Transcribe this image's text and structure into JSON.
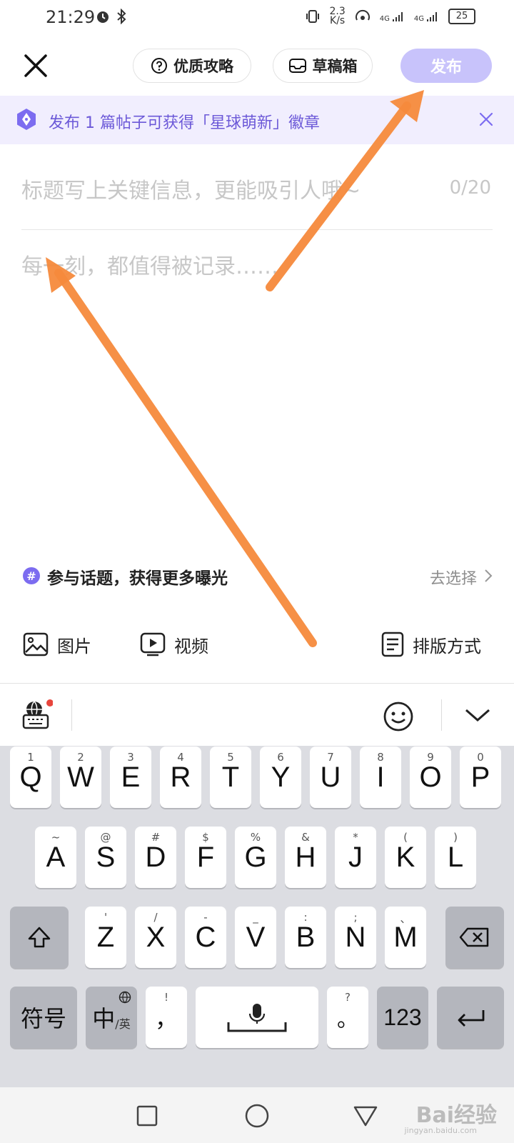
{
  "status_bar": {
    "time": "21:29",
    "net_speed_value": "2.3",
    "net_speed_unit": "K/s",
    "signal_1": "4G",
    "signal_2": "4G",
    "battery": "25"
  },
  "top_bar": {
    "guide_label": "优质攻略",
    "drafts_label": "草稿箱",
    "publish_label": "发布"
  },
  "banner": {
    "text": "发布 1 篇帖子可获得「星球萌新」徽章"
  },
  "editor": {
    "title_placeholder": "标题写上关键信息，更能吸引人哦~",
    "title_counter": "0/20",
    "body_placeholder": "每一刻，都值得被记录……"
  },
  "topic": {
    "icon": "#",
    "label": "参与话题，获得更多曝光",
    "select_label": "去选择"
  },
  "toolbar": {
    "image_label": "图片",
    "video_label": "视频",
    "layout_label": "排版方式"
  },
  "keyboard": {
    "row1": [
      {
        "main": "Q",
        "sup": "1"
      },
      {
        "main": "W",
        "sup": "2"
      },
      {
        "main": "E",
        "sup": "3"
      },
      {
        "main": "R",
        "sup": "4"
      },
      {
        "main": "T",
        "sup": "5"
      },
      {
        "main": "Y",
        "sup": "6"
      },
      {
        "main": "U",
        "sup": "7"
      },
      {
        "main": "I",
        "sup": "8"
      },
      {
        "main": "O",
        "sup": "9"
      },
      {
        "main": "P",
        "sup": "0"
      }
    ],
    "row2": [
      {
        "main": "A",
        "sup": "~"
      },
      {
        "main": "S",
        "sup": "@"
      },
      {
        "main": "D",
        "sup": "#"
      },
      {
        "main": "F",
        "sup": "$"
      },
      {
        "main": "G",
        "sup": "%"
      },
      {
        "main": "H",
        "sup": "&"
      },
      {
        "main": "J",
        "sup": "*"
      },
      {
        "main": "K",
        "sup": "("
      },
      {
        "main": "L",
        "sup": ")"
      }
    ],
    "row3": [
      {
        "main": "Z",
        "sup": "'"
      },
      {
        "main": "X",
        "sup": "/"
      },
      {
        "main": "C",
        "sup": "-"
      },
      {
        "main": "V",
        "sup": "_"
      },
      {
        "main": "B",
        "sup": ":"
      },
      {
        "main": "N",
        "sup": ";"
      },
      {
        "main": "M",
        "sup": "、"
      }
    ],
    "symbols_label": "符号",
    "lang_main": "中",
    "lang_sub": "/英",
    "comma_main": "，",
    "comma_sup": "!",
    "period_main": "。",
    "period_sup": "?",
    "numbers_label": "123"
  },
  "watermark": {
    "text": "Bai经验",
    "sub": "jingyan.baidu.com"
  },
  "colors": {
    "accent": "#6c59d8",
    "publish_disabled": "#c8c3fb",
    "banner_bg": "#f1eefe",
    "arrow": "#f68a3c",
    "notification_dot": "#e8453c"
  }
}
